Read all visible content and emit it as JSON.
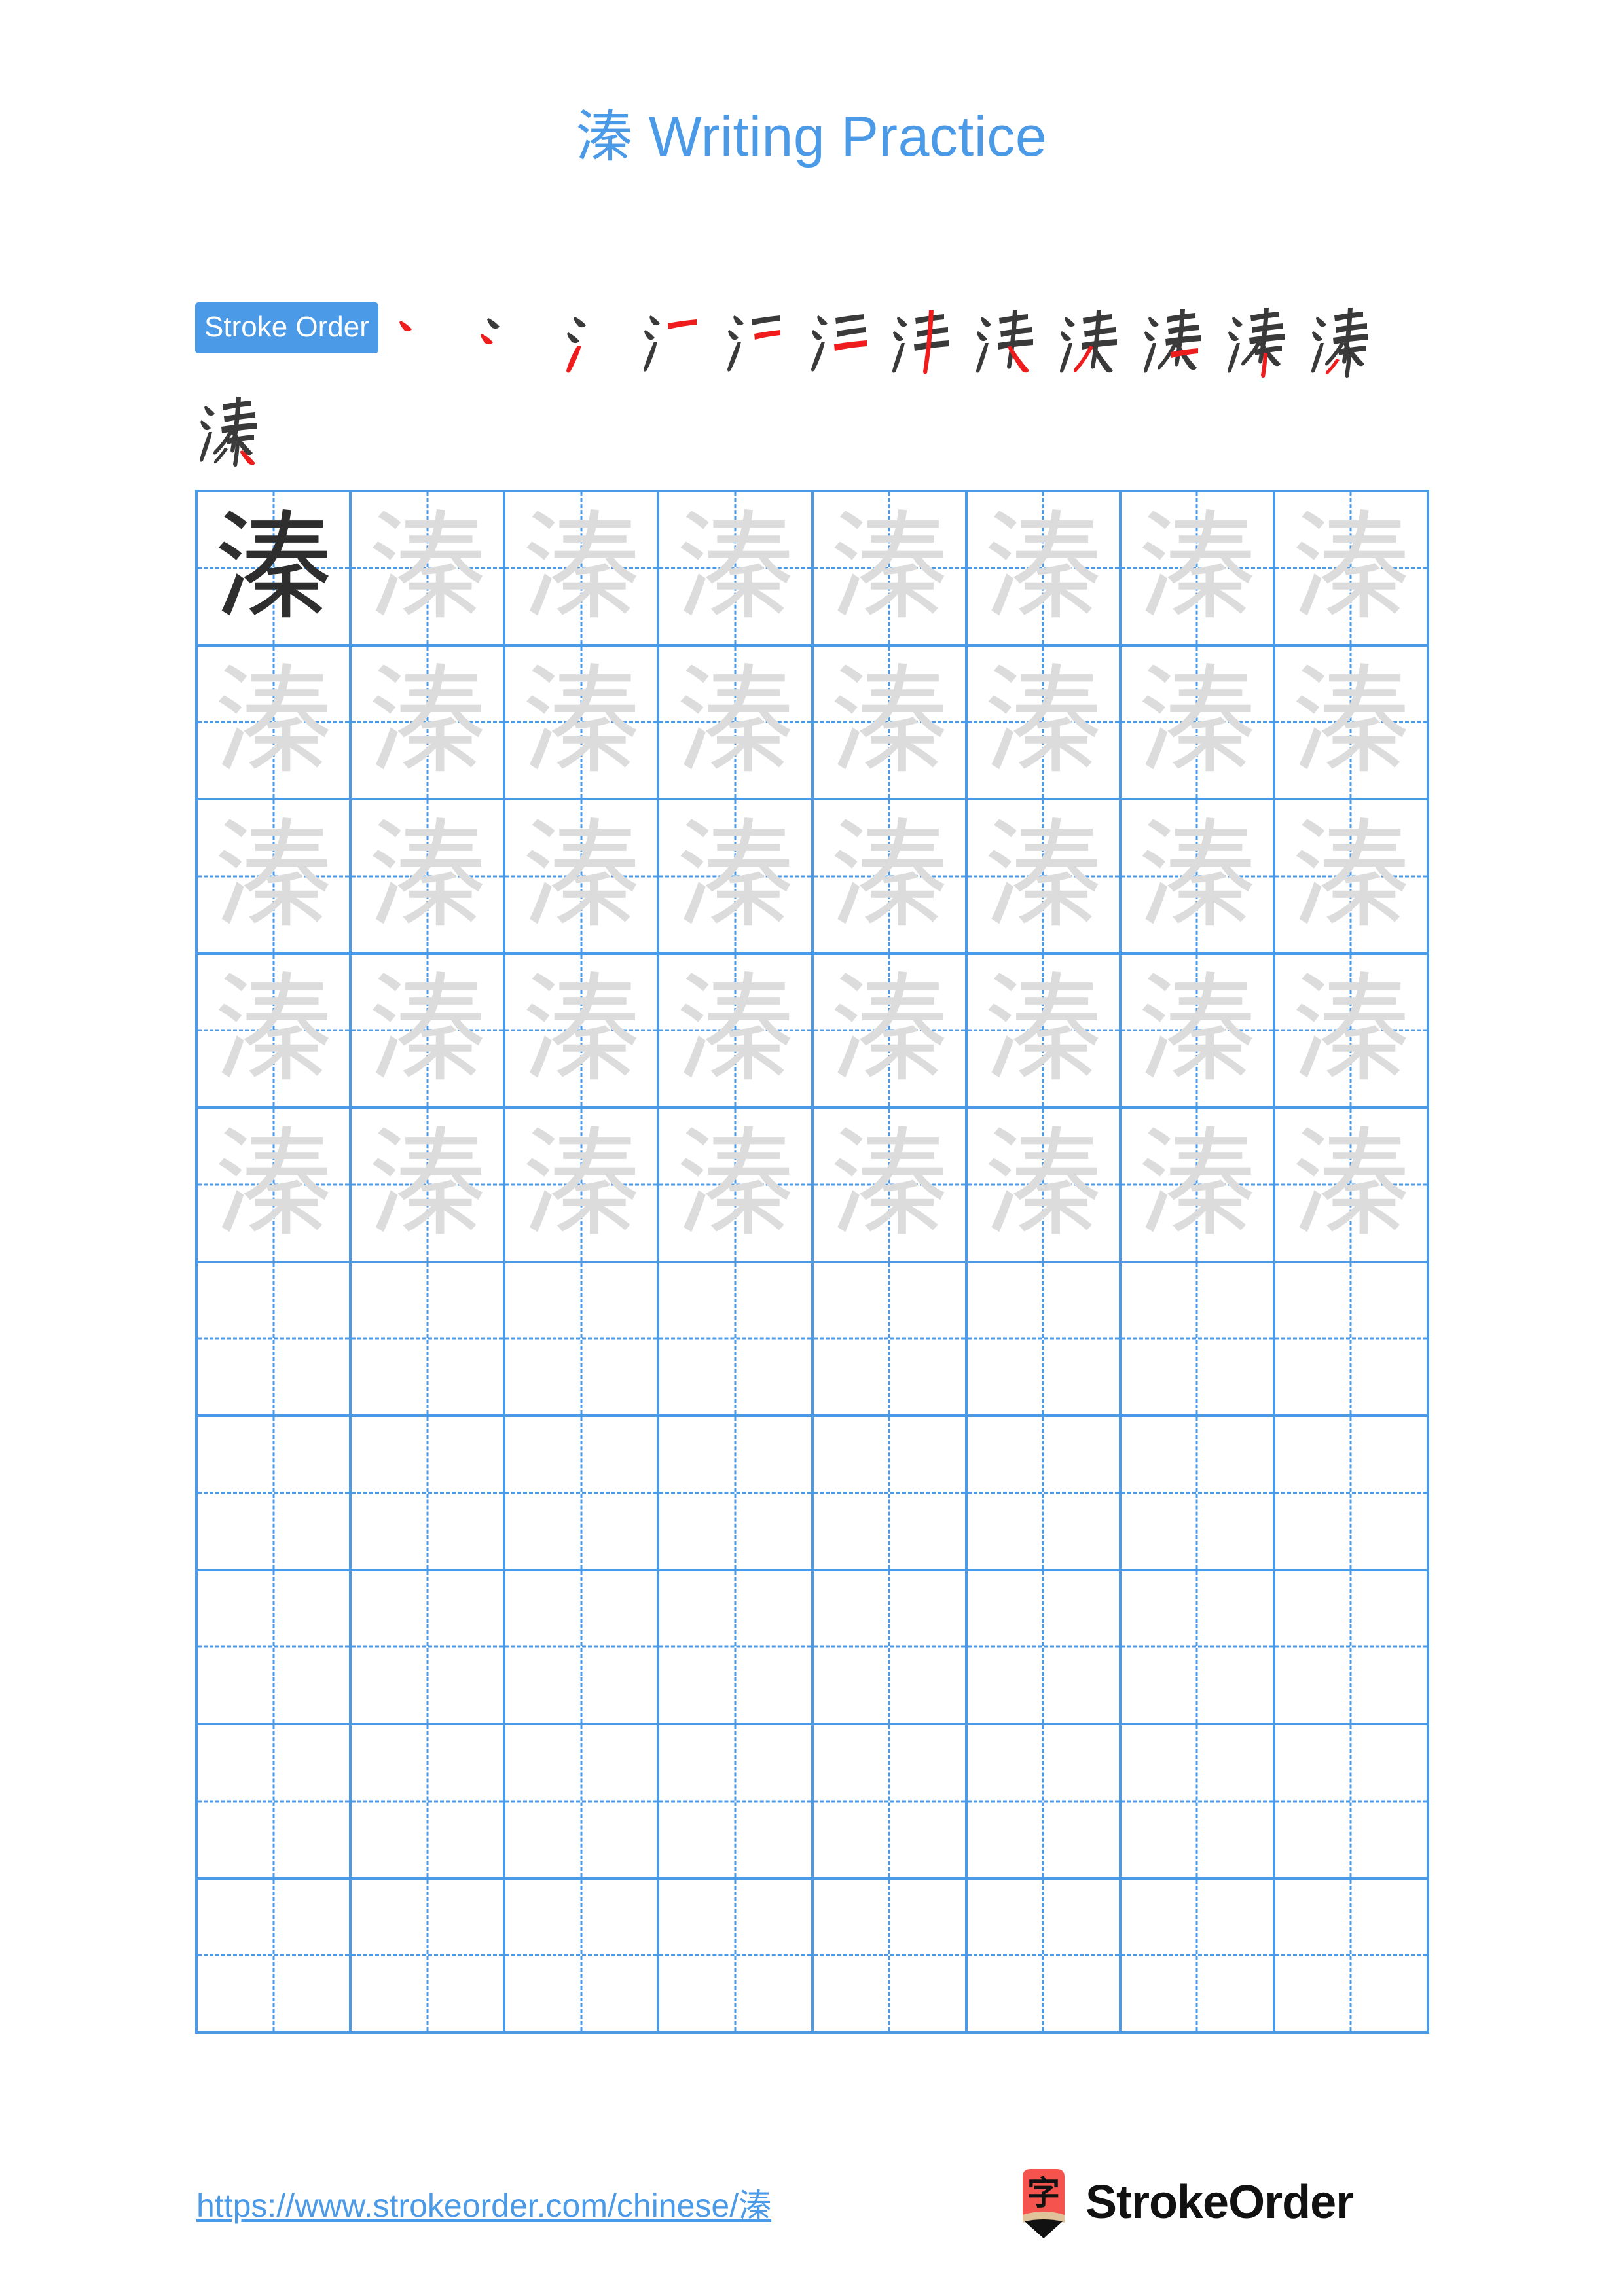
{
  "page": {
    "background_color": "#ffffff",
    "accent_color": "#4a9ae8",
    "model_char_color": "#2e2e2e",
    "trace_char_color": "#dcdcdc",
    "highlight_stroke_color": "#ee1c1c",
    "ink_stroke_color": "#3a3a3a"
  },
  "header": {
    "character": "溱",
    "title_suffix": " Writing Practice"
  },
  "stroke_order": {
    "badge_label": "Stroke Order",
    "total_strokes": 13,
    "steps": [
      {
        "index": 1,
        "partial": "丶"
      },
      {
        "index": 2,
        "partial": "冫"
      },
      {
        "index": 3,
        "partial": "氵"
      },
      {
        "index": 4,
        "partial": "氵一"
      },
      {
        "index": 5,
        "partial": "氵二"
      },
      {
        "index": 6,
        "partial": "氵三"
      },
      {
        "index": 7,
        "partial": "氵丰"
      },
      {
        "index": 8,
        "partial": "洴"
      },
      {
        "index": 9,
        "partial": "洙"
      },
      {
        "index": 10,
        "partial": "溁"
      },
      {
        "index": 11,
        "partial": "溱"
      },
      {
        "index": 12,
        "partial": "溱"
      },
      {
        "index": 13,
        "partial": "溱"
      }
    ]
  },
  "practice_grid": {
    "columns": 8,
    "rows": 10,
    "filled_rows": 5,
    "empty_rows": 5,
    "model_cell": {
      "row": 1,
      "column": 1,
      "character": "溱"
    },
    "trace_character": "溱"
  },
  "footer": {
    "url_text": "https://www.strokeorder.com/chinese/",
    "url_character": "溱",
    "brand_name": "StrokeOrder",
    "logo": {
      "icon_character": "字",
      "body_color": "#f4544d",
      "band_color": "#e0c39a",
      "tip_color": "#111111"
    }
  }
}
